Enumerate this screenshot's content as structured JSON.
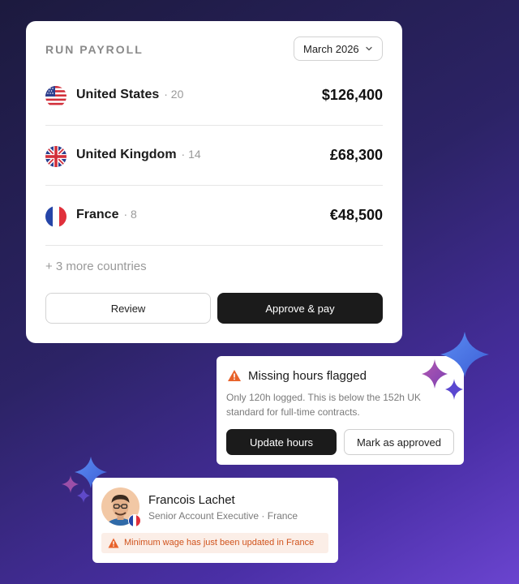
{
  "payroll": {
    "title": "RUN PAYROLL",
    "period": "March 2026",
    "rows": [
      {
        "country": "United States",
        "count": "· 20",
        "amount": "$126,400",
        "flag": "us-flag"
      },
      {
        "country": "United Kingdom",
        "count": "· 14",
        "amount": "£68,300",
        "flag": "uk-flag"
      },
      {
        "country": "France",
        "count": "· 8",
        "amount": "€48,500",
        "flag": "france-flag"
      }
    ],
    "more": "+ 3 more countries",
    "review_label": "Review",
    "approve_label": "Approve & pay"
  },
  "alert": {
    "title": "Missing hours flagged",
    "description": "Only 120h logged. This is below the 152h UK standard for full-time contracts.",
    "update_label": "Update hours",
    "mark_label": "Mark as approved",
    "icon": "warning-icon"
  },
  "employee": {
    "name": "Francois Lachet",
    "role": "Senior Account Executive · France",
    "notice": "Minimum wage has just been updated in France",
    "flag": "france-flag"
  },
  "colors": {
    "background_start": "#1c1a3e",
    "background_end": "#6a44cf",
    "button_dark": "#1b1b1b",
    "warning": "#e8622a",
    "notice_bg": "#fbeee7"
  }
}
